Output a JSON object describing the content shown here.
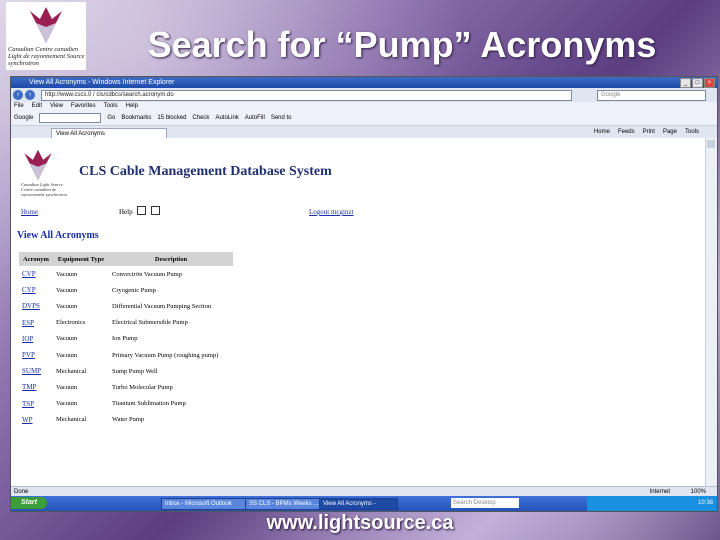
{
  "slide": {
    "title": "Search for “Pump” Acronyms",
    "footer_url": "www.lightsource.ca",
    "logo_text": "Canadian Centre canadien Light de rayonnement Source synchrotron"
  },
  "browser": {
    "window_title": "View All Acronyms - Windows Internet Explorer",
    "address": "http://www.cscs.0 / cls/cdbcs/search.acronym.do",
    "search_placeholder": "Google",
    "menu": [
      "File",
      "Edit",
      "View",
      "Favorites",
      "Tools",
      "Help"
    ],
    "google_toolbar": [
      "Google",
      "Go",
      "Bookmarks",
      "15 blocked",
      "Check",
      "AutoLink",
      "AutoFill",
      "Send to"
    ],
    "tab_label": "View All Acronyms",
    "command_bar": [
      "Home",
      "Feeds",
      "Print",
      "Page",
      "Tools"
    ],
    "status_left": "Done",
    "status_zone": "Internet",
    "status_zoom": "100%"
  },
  "taskbar": {
    "start_label": "Start",
    "tasks": [
      "Inbox - Microsoft Outlook",
      "SS CLS - BPMs Weeks ...",
      "View All Acronyms -"
    ],
    "desktop_search": "Search Desktop",
    "clock": "10:38"
  },
  "page": {
    "app_title": "CLS Cable Management Database System",
    "logo_text": "Canadian Light Source Centre canadien de rayonnement synchrotron",
    "home_link": "Home",
    "help_label": "Help",
    "logout_link": "Logout mcginzt",
    "heading": "View All Acronyms",
    "columns": [
      "Acronym",
      "Equipment Type",
      "Description"
    ],
    "rows": [
      {
        "acronym": "CVP",
        "type": "Vacuum",
        "description": "Convectrön Vacuum Pump"
      },
      {
        "acronym": "CYP",
        "type": "Vacuum",
        "description": "Cryogenic Pump"
      },
      {
        "acronym": "DVPS",
        "type": "Vacuum",
        "description": "Differential Vacuum Pumping Section"
      },
      {
        "acronym": "ESP",
        "type": "Electronics",
        "description": "Electrical Submersible Pump"
      },
      {
        "acronym": "IOP",
        "type": "Vacuum",
        "description": "Ion Pump"
      },
      {
        "acronym": "PVP",
        "type": "Vacuum",
        "description": "Primary Vacuum Pump (roughing pump)"
      },
      {
        "acronym": "SUMP",
        "type": "Mechanical",
        "description": "Sump Pump Well"
      },
      {
        "acronym": "TMP",
        "type": "Vacuum",
        "description": "Turbo Molecular Pump"
      },
      {
        "acronym": "TSP",
        "type": "Vacuum",
        "description": "Titanium Sublimation Pump"
      },
      {
        "acronym": "WP",
        "type": "Mechanical",
        "description": "Water Pump"
      }
    ]
  },
  "colors": {
    "link": "#1a2ea8",
    "slide_accent": "#5b3d80",
    "titlebar": "#1d4aa8"
  }
}
